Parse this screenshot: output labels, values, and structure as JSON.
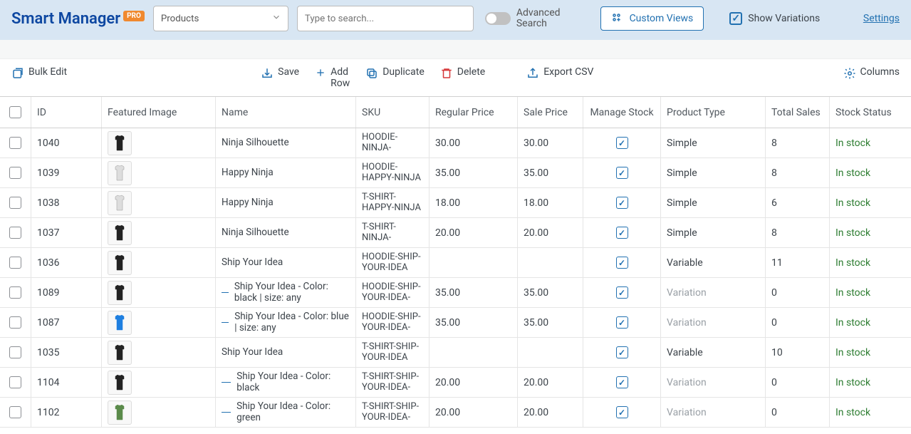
{
  "brand": {
    "name": "Smart Manager",
    "badge": "PRO"
  },
  "dashboard": {
    "selected": "Products"
  },
  "search": {
    "placeholder": "Type to search..."
  },
  "advanced": {
    "line1": "Advanced",
    "line2": "Search"
  },
  "custom_views": {
    "label": "Custom Views"
  },
  "show_variations": {
    "label": "Show Variations",
    "checked": true
  },
  "settings": {
    "label": "Settings"
  },
  "toolbar": {
    "bulk_edit": "Bulk Edit",
    "save": "Save",
    "add_row_l1": "Add",
    "add_row_l2": "Row",
    "duplicate": "Duplicate",
    "delete": "Delete",
    "export": "Export CSV",
    "columns": "Columns"
  },
  "columns": {
    "id": "ID",
    "img": "Featured Image",
    "name": "Name",
    "sku": "SKU",
    "reg": "Regular Price",
    "sale": "Sale Price",
    "stock": "Manage Stock",
    "type": "Product Type",
    "sales": "Total Sales",
    "status": "Stock Status"
  },
  "rows": [
    {
      "id": "1040",
      "thumb": "black",
      "name": "Ninja Silhouette",
      "sku": "HOODIE-NINJA-",
      "reg": "30.00",
      "sale": "30.00",
      "stock": true,
      "type": "Simple",
      "variation": false,
      "indent": false,
      "sales": "8",
      "status": "In stock"
    },
    {
      "id": "1039",
      "thumb": "white",
      "name": "Happy Ninja",
      "sku": "HOODIE-HAPPY-NINJA",
      "reg": "35.00",
      "sale": "35.00",
      "stock": true,
      "type": "Simple",
      "variation": false,
      "indent": false,
      "sales": "8",
      "status": "In stock"
    },
    {
      "id": "1038",
      "thumb": "white",
      "name": "Happy Ninja",
      "sku": "T-SHIRT-HAPPY-NINJA",
      "reg": "18.00",
      "sale": "18.00",
      "stock": true,
      "type": "Simple",
      "variation": false,
      "indent": false,
      "sales": "6",
      "status": "In stock"
    },
    {
      "id": "1037",
      "thumb": "black",
      "name": "Ninja Silhouette",
      "sku": "T-SHIRT-NINJA-",
      "reg": "20.00",
      "sale": "20.00",
      "stock": true,
      "type": "Simple",
      "variation": false,
      "indent": false,
      "sales": "8",
      "status": "In stock"
    },
    {
      "id": "1036",
      "thumb": "black",
      "name": "Ship Your Idea",
      "sku": "HOODIE-SHIP-YOUR-IDEA",
      "reg": "",
      "sale": "",
      "stock": true,
      "type": "Variable",
      "variation": false,
      "indent": false,
      "sales": "11",
      "status": "In stock"
    },
    {
      "id": "1089",
      "thumb": "black",
      "name": "Ship Your Idea - Color: black | size: any",
      "sku": "HOODIE-SHIP-YOUR-IDEA-",
      "reg": "35.00",
      "sale": "35.00",
      "stock": true,
      "type": "Variation",
      "variation": true,
      "indent": true,
      "sales": "0",
      "status": "In stock"
    },
    {
      "id": "1087",
      "thumb": "blue",
      "name": "Ship Your Idea - Color: blue | size: any",
      "sku": "HOODIE-SHIP-YOUR-IDEA-",
      "reg": "35.00",
      "sale": "35.00",
      "stock": true,
      "type": "Variation",
      "variation": true,
      "indent": true,
      "sales": "0",
      "status": "In stock"
    },
    {
      "id": "1035",
      "thumb": "black",
      "name": "Ship Your Idea",
      "sku": "T-SHIRT-SHIP-YOUR-IDEA",
      "reg": "",
      "sale": "",
      "stock": true,
      "type": "Variable",
      "variation": false,
      "indent": false,
      "sales": "10",
      "status": "In stock"
    },
    {
      "id": "1104",
      "thumb": "black",
      "name": "Ship Your Idea - Color: black",
      "sku": "T-SHIRT-SHIP-YOUR-IDEA-",
      "reg": "20.00",
      "sale": "20.00",
      "stock": true,
      "type": "Variation",
      "variation": true,
      "indent": true,
      "sales": "0",
      "status": "In stock"
    },
    {
      "id": "1102",
      "thumb": "green",
      "name": "Ship Your Idea - Color: green",
      "sku": "T-SHIRT-SHIP-YOUR-IDEA-",
      "reg": "20.00",
      "sale": "20.00",
      "stock": true,
      "type": "Variation",
      "variation": true,
      "indent": true,
      "sales": "0",
      "status": "In stock"
    }
  ]
}
